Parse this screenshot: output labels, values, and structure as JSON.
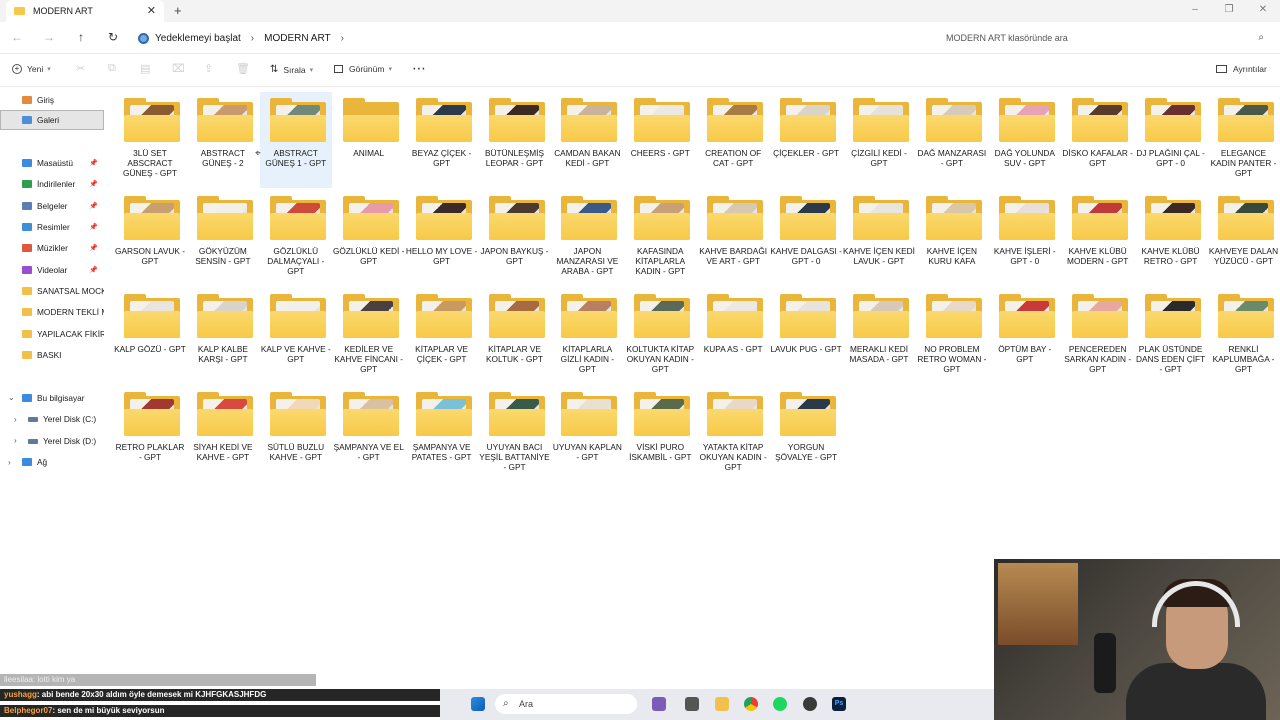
{
  "tab": {
    "title": "MODERN ART",
    "close": "✕",
    "new": "+"
  },
  "window_controls": [
    "–",
    "❐",
    "✕"
  ],
  "nav": {
    "back": "←",
    "forward": "→",
    "up": "↑",
    "refresh": "↻"
  },
  "breadcrumbs": {
    "backup": "Yedeklemeyi başlat",
    "current": "MODERN ART",
    "sep": "›"
  },
  "search": {
    "placeholder": "MODERN ART klasöründe ara",
    "icon": "⌕"
  },
  "toolbar": {
    "new": "Yeni",
    "sort": "Sırala",
    "view": "Görünüm",
    "more": "⋯",
    "details": "Ayrıntılar"
  },
  "sidebar": {
    "items": [
      {
        "label": "Giriş",
        "color": "#e48b3b"
      },
      {
        "label": "Galeri",
        "color": "#4a8fd8"
      },
      {
        "label": "Masaüstü",
        "color": "#3b8be0"
      },
      {
        "label": "İndirilenler",
        "color": "#2f9e4f"
      },
      {
        "label": "Belgeler",
        "color": "#5a7fb5"
      },
      {
        "label": "Resimler",
        "color": "#3e8fd6"
      },
      {
        "label": "Müzikler",
        "color": "#e0573b"
      },
      {
        "label": "Videolar",
        "color": "#9b4fd0"
      },
      {
        "label": "SANATSAL MOCKU",
        "color": "#f1c04a"
      },
      {
        "label": "MODERN TEKLİ MC",
        "color": "#f1c04a"
      },
      {
        "label": "YAPILACAK FİKİRLE",
        "color": "#f1c04a"
      },
      {
        "label": "BASKI",
        "color": "#f1c04a"
      },
      {
        "label": "Bu bilgisayar",
        "color": "#3b8be0"
      },
      {
        "label": "Yerel Disk (C:)",
        "color": "#5f7b99"
      },
      {
        "label": "Yerel Disk (D:)",
        "color": "#5f7b99"
      },
      {
        "label": "Ağ",
        "color": "#3b8be0"
      }
    ]
  },
  "folders": [
    {
      "name": "3LÜ SET ABSCRACT GÜNEŞ - GPT",
      "thumb": "#8a5a30"
    },
    {
      "name": "ABSTRACT GÜNEŞ - 2",
      "thumb": "#c99a6d"
    },
    {
      "name": "ABSTRACT GÜNEŞ 1 - GPT",
      "thumb": "#6f8a7a"
    },
    {
      "name": "ANIMAL",
      "thumb": ""
    },
    {
      "name": "BEYAZ ÇİÇEK - GPT",
      "thumb": "#2b3a4a"
    },
    {
      "name": "BÜTÜNLEŞMİŞ LEOPAR - GPT",
      "thumb": "#3a2a22"
    },
    {
      "name": "CAMDAN BAKAN KEDİ - GPT",
      "thumb": "#c9b49a"
    },
    {
      "name": "CHEERS - GPT",
      "thumb": "#ece8e2"
    },
    {
      "name": "CREATION OF CAT - GPT",
      "thumb": "#a87a45"
    },
    {
      "name": "ÇİÇEKLER - GPT",
      "thumb": "#d9d3c8"
    },
    {
      "name": "ÇİZGİLİ KEDİ - GPT",
      "thumb": "#e6e2da"
    },
    {
      "name": "DAĞ MANZARASI - GPT",
      "thumb": "#d5cbb8"
    },
    {
      "name": "DAĞ YOLUNDA SUV - GPT",
      "thumb": "#e8a2b8"
    },
    {
      "name": "DİSKO KAFALAR - GPT",
      "thumb": "#5a3a2a"
    },
    {
      "name": "DJ PLAĞINI ÇAL - GPT - 0",
      "thumb": "#6a3030"
    },
    {
      "name": "ELEGANCE KADIN PANTER - GPT",
      "thumb": "#4a5a4a"
    },
    {
      "name": "GARSON LAVUK - GPT",
      "thumb": "#c8a070"
    },
    {
      "name": "GÖKYÜZÜM SENSİN - GPT",
      "thumb": "#f2efe8"
    },
    {
      "name": "GÖZLÜKLÜ DALMAÇYALI - GPT",
      "thumb": "#d04a3a"
    },
    {
      "name": "GÖZLÜKLÜ KEDİ - GPT",
      "thumb": "#e89aa8"
    },
    {
      "name": "HELLO MY LOVE - GPT",
      "thumb": "#3a2a2a"
    },
    {
      "name": "JAPON BAYKUŞ - GPT",
      "thumb": "#4a3a30"
    },
    {
      "name": "JAPON MANZARASI VE ARABA - GPT",
      "thumb": "#3a5a8a"
    },
    {
      "name": "KAFASINDA KİTAPLARLA KADIN - GPT",
      "thumb": "#c8a078"
    },
    {
      "name": "KAHVE BARDAĞI VE ART - GPT",
      "thumb": "#d8c8b0"
    },
    {
      "name": "KAHVE DALGASI - GPT - 0",
      "thumb": "#2a3a4a"
    },
    {
      "name": "KAHVE İÇEN KEDİ LAVUK - GPT",
      "thumb": "#e8e4de"
    },
    {
      "name": "KAHVE İÇEN KURU KAFA",
      "thumb": "#d8c8a8"
    },
    {
      "name": "KAHVE İŞLERİ - GPT - 0",
      "thumb": "#e8e0d8"
    },
    {
      "name": "KAHVE KLÜBÜ MODERN - GPT",
      "thumb": "#c03a3a"
    },
    {
      "name": "KAHVE KLÜBÜ RETRO - GPT",
      "thumb": "#3a2a22"
    },
    {
      "name": "KAHVEYE DALAN YÜZÜCÜ - GPT",
      "thumb": "#3a4a3a"
    },
    {
      "name": "KALP GÖZÜ - GPT",
      "thumb": "#e8e4e0"
    },
    {
      "name": "KALP KALBE KARŞI - GPT",
      "thumb": "#d8d4cc"
    },
    {
      "name": "KALP VE KAHVE - GPT",
      "thumb": "#f2f0ea"
    },
    {
      "name": "KEDİLER VE KAHVE FİNCANI - GPT",
      "thumb": "#4a4040"
    },
    {
      "name": "KİTAPLAR VE ÇİÇEK - GPT",
      "thumb": "#c89a60"
    },
    {
      "name": "KİTAPLAR VE KOLTUK - GPT",
      "thumb": "#a86a40"
    },
    {
      "name": "KİTAPLARLA GİZLİ KADIN - GPT",
      "thumb": "#b88060"
    },
    {
      "name": "KOLTUKTA KİTAP OKUYAN KADIN - GPT",
      "thumb": "#5a6a5a"
    },
    {
      "name": "KUPA AS - GPT",
      "thumb": "#ece8e2"
    },
    {
      "name": "LAVUK PUG - GPT",
      "thumb": "#e8e4dc"
    },
    {
      "name": "MERAKLI KEDİ MASADA - GPT",
      "thumb": "#d8c8b8"
    },
    {
      "name": "NO PROBLEM RETRO WOMAN - GPT",
      "thumb": "#e8d8c8"
    },
    {
      "name": "ÖPTÜM BAY - GPT",
      "thumb": "#c83a3a"
    },
    {
      "name": "PENCEREDEN SARKAN KADIN - GPT",
      "thumb": "#e8a8a0"
    },
    {
      "name": "PLAK ÜSTÜNDE DANS EDEN ÇİFT - GPT",
      "thumb": "#2a2a2a"
    },
    {
      "name": "RENKLİ KAPLUMBAĞA - GPT",
      "thumb": "#6a8a6a"
    },
    {
      "name": "RETRO PLAKLAR - GPT",
      "thumb": "#a03a30"
    },
    {
      "name": "SİYAH KEDİ VE KAHVE - GPT",
      "thumb": "#d84a40"
    },
    {
      "name": "SÜTLÜ BUZLU KAHVE - GPT",
      "thumb": "#f0d8b8"
    },
    {
      "name": "ŞAMPANYA VE EL - GPT",
      "thumb": "#d8c0a0"
    },
    {
      "name": "ŞAMPANYA VE PATATES - GPT",
      "thumb": "#7ac0d8"
    },
    {
      "name": "UYUYAN BACI YEŞİL BATTANİYE - GPT",
      "thumb": "#3a5a4a"
    },
    {
      "name": "UYUYAN KAPLAN - GPT",
      "thumb": "#e8e0d0"
    },
    {
      "name": "VİSKİ PURO İSKAMBİL - GPT",
      "thumb": "#5a6a4a"
    },
    {
      "name": "YATAKTA KİTAP OKUYAN KADIN - GPT",
      "thumb": "#e8d8c8"
    },
    {
      "name": "YORGUN ŞÖVALYE - GPT",
      "thumb": "#2a3a4a"
    }
  ],
  "chat": [
    {
      "user": "lleesilaa",
      "text": ": lotti kim ya"
    },
    {
      "user": "yushagg",
      "text": ": abi bende 20x30 aldım öyle demesek mi KJHFGKASJHFDG"
    },
    {
      "user": "Belphegor07",
      "text": ": sen de mi büyük seviyorsun"
    }
  ],
  "taskbar": {
    "search": "Ara"
  }
}
